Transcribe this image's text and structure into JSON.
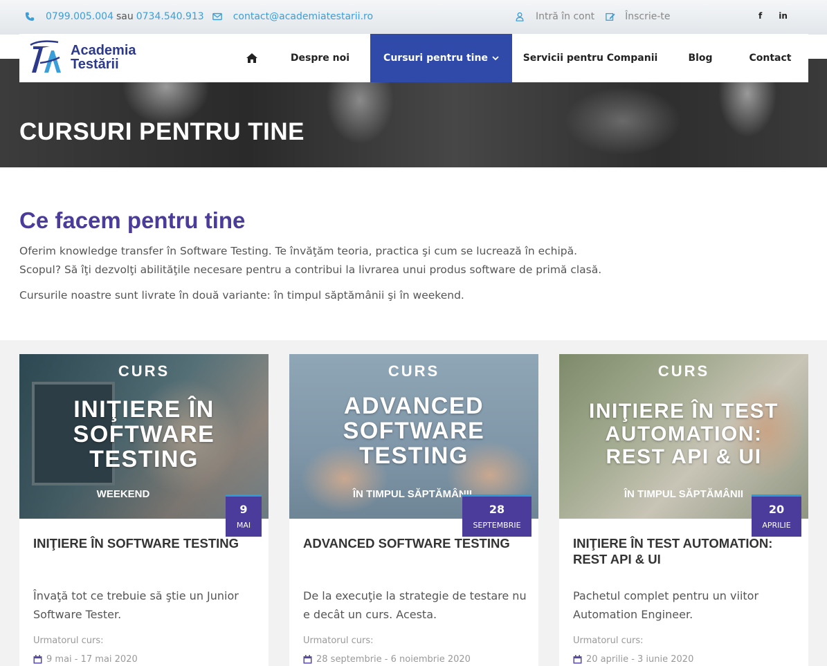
{
  "topbar": {
    "phone1": "0799.005.004",
    "separator": "sau",
    "phone2": "0734.540.913",
    "email": "contact@academiatestarii.ro",
    "login": "Intră în cont",
    "signup": "Înscrie-te",
    "social": {
      "facebook": "f",
      "linkedin": "in"
    },
    "icons": [
      "phone-icon",
      "envelope-icon",
      "user-icon",
      "edit-icon",
      "facebook-icon",
      "linkedin-icon"
    ]
  },
  "logo": {
    "line1": "Academia",
    "line2": "Testării"
  },
  "nav": {
    "home_icon": "home-icon",
    "items": [
      "Despre noi",
      "Cursuri pentru tine",
      "Servicii pentru Companii",
      "Blog",
      "Contact"
    ],
    "active_index": 1
  },
  "hero": {
    "title": "CURSURI PENTRU TINE"
  },
  "intro": {
    "heading": "Ce facem pentru tine",
    "line1": "Oferim knowledge transfer în Software Testing. Te învăţăm teoria, practica şi cum se lucrează în echipă.",
    "line2": "Scopul? Să îţi dezvolţi abilităţile necesare pentru a contribui la livrarea unui produs software de primă clasă.",
    "line3": "Cursurile noastre sunt livrate în două variante: în timpul săptămânii şi în weekend."
  },
  "courses": [
    {
      "img_label": "CURS",
      "img_title": [
        "INIŢIERE ÎN",
        "SOFTWARE",
        "TESTING"
      ],
      "img_sub": "WEEKEND",
      "day": "9",
      "month": "MAI",
      "title": "INIŢIERE ÎN SOFTWARE TESTING",
      "desc": "Învaţă tot ce trebuie să ştie un Junior Software Tester.",
      "next_label": "Urmatorul curs:",
      "range": "9 mai - 17 mai 2020"
    },
    {
      "img_label": "CURS",
      "img_title": [
        "ADVANCED",
        "SOFTWARE",
        "TESTING"
      ],
      "img_sub": "ÎN TIMPUL SĂPTĂMÂNII",
      "day": "28",
      "month": "SEPTEMBRIE",
      "title": "ADVANCED SOFTWARE TESTING",
      "desc": "De la execuţie la strategie de testare nu e decât un curs. Acesta.",
      "next_label": "Urmatorul curs:",
      "range": "28 septembrie - 6 noiembrie 2020"
    },
    {
      "img_label": "CURS",
      "img_title": [
        "INIŢIERE ÎN TEST",
        "AUTOMATION:",
        "REST API & UI"
      ],
      "img_sub": "ÎN TIMPUL SĂPTĂMÂNII",
      "day": "20",
      "month": "APRILIE",
      "title": "INIŢIERE ÎN TEST AUTOMATION: REST API & UI",
      "desc": "Pachetul complet pentru un viitor Automation Engineer.",
      "next_label": "Urmatorul curs:",
      "range": "20 aprilie - 3 iunie 2020"
    }
  ],
  "colors": {
    "brand_purple": "#4b3b9a",
    "nav_active": "#2f4aa8",
    "accent_blue": "#3a9fd8"
  }
}
